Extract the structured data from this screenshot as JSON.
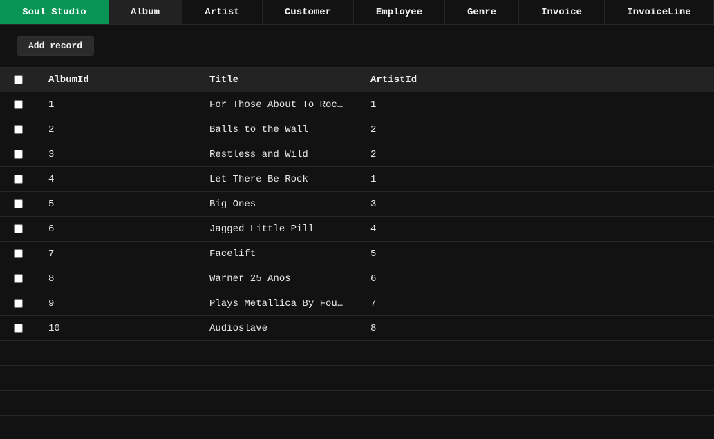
{
  "tabs": [
    {
      "label": "Soul Studio",
      "width": 157,
      "kind": "brand"
    },
    {
      "label": "Album",
      "width": 107,
      "kind": "active"
    },
    {
      "label": "Artist",
      "width": 116,
      "kind": "normal"
    },
    {
      "label": "Customer",
      "width": 132,
      "kind": "normal"
    },
    {
      "label": "Employee",
      "width": 132,
      "kind": "normal"
    },
    {
      "label": "Genre",
      "width": 107,
      "kind": "normal"
    },
    {
      "label": "Invoice",
      "width": 124,
      "kind": "normal"
    },
    {
      "label": "InvoiceLine",
      "width": 158,
      "kind": "normal"
    }
  ],
  "toolbar": {
    "add_label": "Add record"
  },
  "table": {
    "columns": [
      "AlbumId",
      "Title",
      "ArtistId"
    ],
    "rows": [
      [
        "1",
        "For Those About To Rock We Salute You",
        "1"
      ],
      [
        "2",
        "Balls to the Wall",
        "2"
      ],
      [
        "3",
        "Restless and Wild",
        "2"
      ],
      [
        "4",
        "Let There Be Rock",
        "1"
      ],
      [
        "5",
        "Big Ones",
        "3"
      ],
      [
        "6",
        "Jagged Little Pill",
        "4"
      ],
      [
        "7",
        "Facelift",
        "5"
      ],
      [
        "8",
        "Warner 25 Anos",
        "6"
      ],
      [
        "9",
        "Plays Metallica By Four Cellos",
        "7"
      ],
      [
        "10",
        "Audioslave",
        "8"
      ]
    ],
    "empty_rows": 3
  }
}
